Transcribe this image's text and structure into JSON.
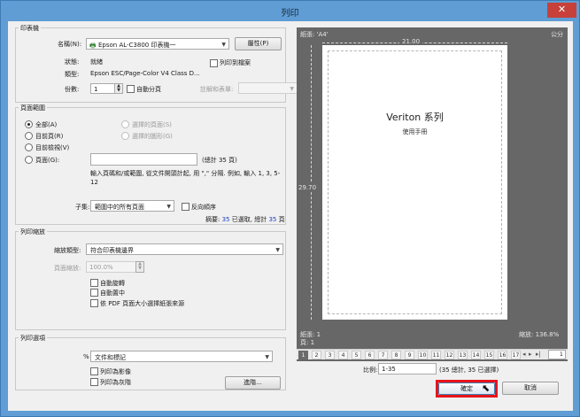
{
  "window": {
    "title": "列印",
    "close_glyph": "✕"
  },
  "printer": {
    "group_label": "印表機",
    "name_label": "名稱(N):",
    "name_value": "Epson AL-C3800 印表機一",
    "properties_button": "屬性(P)",
    "status_label": "狀態:",
    "status_value": "就緒",
    "type_label": "類型:",
    "type_value": "Epson ESC/Page-Color V4 Class D...",
    "print_to_file": "列印到檔案",
    "copies_label": "份數:",
    "copies_value": "1",
    "collate": "自動分頁",
    "comments_label": "註解和表單:"
  },
  "range": {
    "group_label": "頁面範圍",
    "all": "全部(A)",
    "current_page": "目前頁(R)",
    "current_view": "目前檢視(V)",
    "pages": "頁面(G):",
    "selected_pages": "選擇的頁面(S)",
    "selected_graphics": "選擇的圖形(G)",
    "total_note": "(總計 35 頁)",
    "help_text": "輸入頁碼和/或範圍, 從文件開頭計起, 用 \",\" 分隔. 例如, 輸入 1, 3, 5-12",
    "subset_label": "子集:",
    "subset_value": "範圍中的所有頁面",
    "reverse": "反向順序",
    "summary_prefix": "摘要:",
    "summary_selected": "35",
    "summary_mid": "已選取, 總計",
    "summary_total": "35",
    "summary_suffix": "頁"
  },
  "scaling": {
    "group_label": "列印縮放",
    "scale_type_label": "縮放類型:",
    "scale_type_value": "符合印表機邊界",
    "zoom_label": "頁面縮放:",
    "zoom_value": "100.0%",
    "auto_rotate": "自動旋轉",
    "auto_center": "自動置中",
    "paper_by_pdf": "依 PDF 頁面大小選擇紙張來源"
  },
  "options": {
    "group_label": "列印選項",
    "percent_glyph": "%",
    "content_value": "文件和標記",
    "print_as_image": "列印為影像",
    "print_grayscale": "列印為灰階",
    "advanced_button": "進階..."
  },
  "preview": {
    "paper_label": "紙張: 'A4'",
    "units": "公分",
    "width_value": "21.00",
    "height_value": "29.70",
    "doc_title": "Veriton 系列",
    "doc_subtitle": "使用手冊",
    "sheet_label": "紙張: 1",
    "page_label": "頁: 1",
    "zoom_label": "縮放: 136.8%",
    "page_numbers": [
      "1",
      "2",
      "3",
      "4",
      "5",
      "6",
      "7",
      "8",
      "9",
      "10",
      "11",
      "12",
      "13",
      "14",
      "15",
      "16",
      "17"
    ],
    "current_page_input": "1",
    "ratio_label": "比例:",
    "ratio_value": "1-35",
    "ratio_note": "(35 總計, 35 已選擇)"
  },
  "footer": {
    "ok_button": "確定",
    "cancel_button": "取消"
  },
  "colors": {
    "title_bar": "#5f9dd4",
    "close": "#c7413a",
    "highlight": "#e8141b",
    "link_blue": "#1a3fbf"
  }
}
